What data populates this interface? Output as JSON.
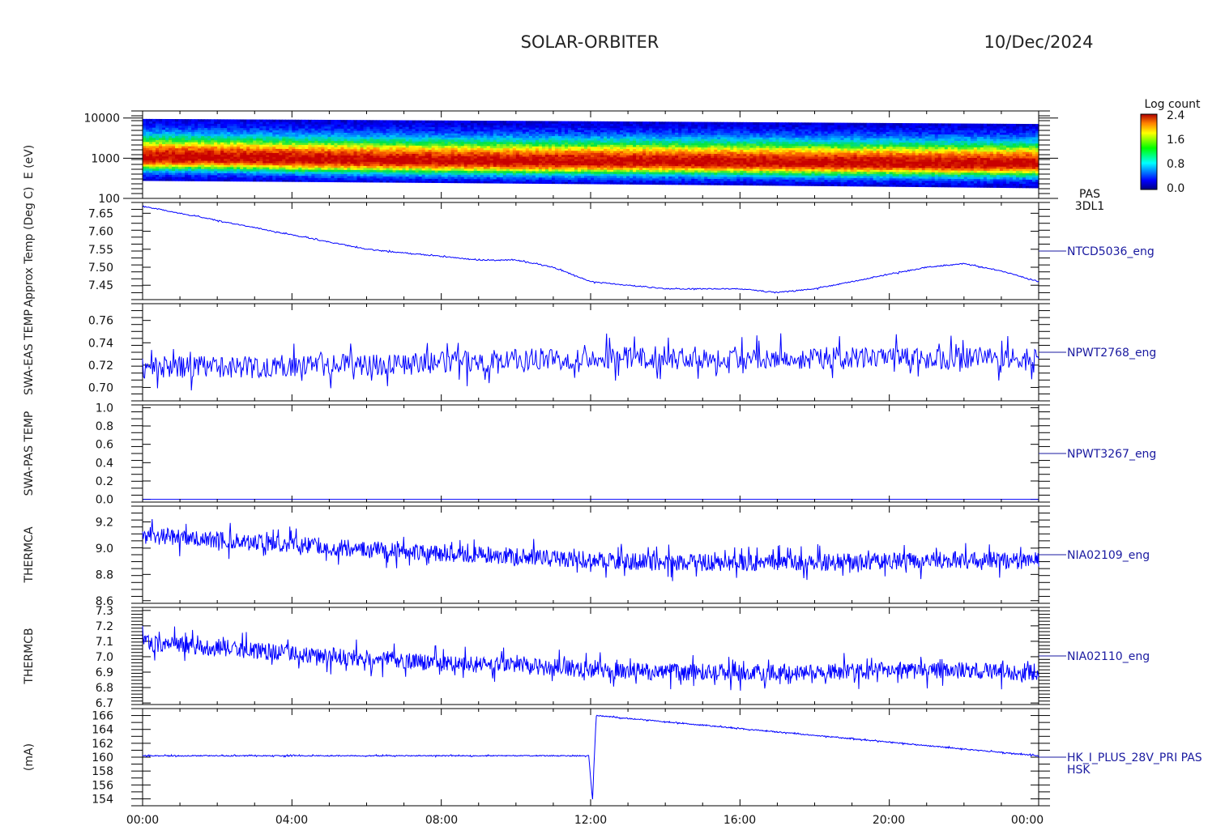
{
  "header": {
    "mission": "SOLAR-ORBITER",
    "date": "10/Dec/2024"
  },
  "colorbar": {
    "title": "Log count",
    "ticks": [
      "2.4",
      "1.6",
      "0.8",
      "0.0"
    ]
  },
  "time_axis": {
    "ticks": [
      "00:00",
      "04:00",
      "08:00",
      "12:00",
      "16:00",
      "20:00",
      "00:00"
    ]
  },
  "colors": {
    "trace": "#0000ff",
    "label": "#1a1aa0",
    "axis": "#000000"
  },
  "chart_data": [
    {
      "type": "heatmap",
      "name": "spectrogram",
      "labels": [
        "PAS",
        "3DL1"
      ],
      "ylabel": "E (eV)",
      "y_scale": "log",
      "ylim": [
        100,
        15000
      ],
      "yticks": [
        "10000",
        "1000",
        "100"
      ],
      "peak_energy_eV": [
        1050,
        1040,
        950,
        900,
        860,
        830,
        830,
        820,
        800,
        770,
        760,
        740,
        740
      ],
      "x_hours": [
        0,
        2,
        4,
        6,
        8,
        10,
        12,
        14,
        16,
        18,
        20,
        22,
        24
      ],
      "colorbar_range": [
        0.0,
        2.4
      ]
    },
    {
      "type": "line",
      "name": "NTCD5036_eng",
      "ylabel": "Approx Temp (Deg C)",
      "ylim": [
        7.41,
        7.68
      ],
      "yticks": [
        "7.65",
        "7.60",
        "7.55",
        "7.50",
        "7.45"
      ],
      "x": [
        0,
        1,
        2,
        3,
        4,
        5,
        6,
        7,
        8,
        9,
        10,
        11,
        12,
        13,
        14,
        15,
        16,
        17,
        18,
        19,
        20,
        21,
        22,
        23,
        24
      ],
      "y": [
        7.67,
        7.65,
        7.63,
        7.61,
        7.59,
        7.57,
        7.55,
        7.54,
        7.53,
        7.52,
        7.52,
        7.5,
        7.46,
        7.45,
        7.44,
        7.44,
        7.44,
        7.43,
        7.44,
        7.46,
        7.48,
        7.5,
        7.51,
        7.49,
        7.46
      ],
      "noise": 0.003
    },
    {
      "type": "line",
      "name": "NPWT2768_eng",
      "ylabel": "SWA-EAS TEMP",
      "ylim": [
        0.688,
        0.775
      ],
      "yticks": [
        "0.76",
        "0.74",
        "0.72",
        "0.70"
      ],
      "x": [
        0,
        4,
        8,
        12,
        16,
        20,
        24
      ],
      "y": [
        0.718,
        0.719,
        0.722,
        0.727,
        0.727,
        0.726,
        0.725
      ],
      "noise": 0.02
    },
    {
      "type": "line",
      "name": "NPWT3267_eng",
      "ylabel": "SWA-PAS TEMP",
      "ylim": [
        -0.03,
        1.03
      ],
      "yticks": [
        "1.0",
        "0.8",
        "0.6",
        "0.4",
        "0.2",
        "0.0"
      ],
      "x": [
        0,
        24
      ],
      "y": [
        0.0,
        0.0
      ],
      "noise": 0.0
    },
    {
      "type": "line",
      "name": "NIA02109_eng",
      "ylabel": "THERMCA",
      "ylim": [
        8.58,
        9.32
      ],
      "yticks": [
        "9.2",
        "9.0",
        "8.8",
        "8.6"
      ],
      "x": [
        0,
        2,
        4,
        6,
        8,
        10,
        12,
        14,
        16,
        18,
        20,
        22,
        24
      ],
      "y": [
        9.1,
        9.06,
        9.03,
        8.99,
        8.96,
        8.94,
        8.91,
        8.89,
        8.89,
        8.89,
        8.9,
        8.91,
        8.9
      ],
      "noise": 0.13
    },
    {
      "type": "line",
      "name": "NIA02110_eng",
      "ylabel": "THERMCB",
      "ylim": [
        6.69,
        7.32
      ],
      "yticks": [
        "7.3",
        "7.2",
        "7.1",
        "7.0",
        "6.9",
        "6.8",
        "6.7"
      ],
      "x": [
        0,
        2,
        4,
        6,
        8,
        10,
        12,
        14,
        16,
        18,
        20,
        22,
        24
      ],
      "y": [
        7.09,
        7.06,
        7.02,
        6.99,
        6.96,
        6.94,
        6.92,
        6.9,
        6.9,
        6.9,
        6.91,
        6.91,
        6.9
      ],
      "noise": 0.11
    },
    {
      "type": "line",
      "name": "HK_I_PLUS_28V_PRI PAS",
      "labels": [
        "HK_I_PLUS_28V_PRI PAS",
        "HSK"
      ],
      "ylabel": "(mA)",
      "ylim": [
        153,
        167
      ],
      "yticks": [
        "166",
        "164",
        "162",
        "160",
        "158",
        "156",
        "154"
      ],
      "x": [
        0,
        11.95,
        12.05,
        12.15,
        24
      ],
      "y": [
        160.2,
        160.2,
        153.8,
        166.0,
        160.2
      ],
      "noise": 0.15
    }
  ]
}
